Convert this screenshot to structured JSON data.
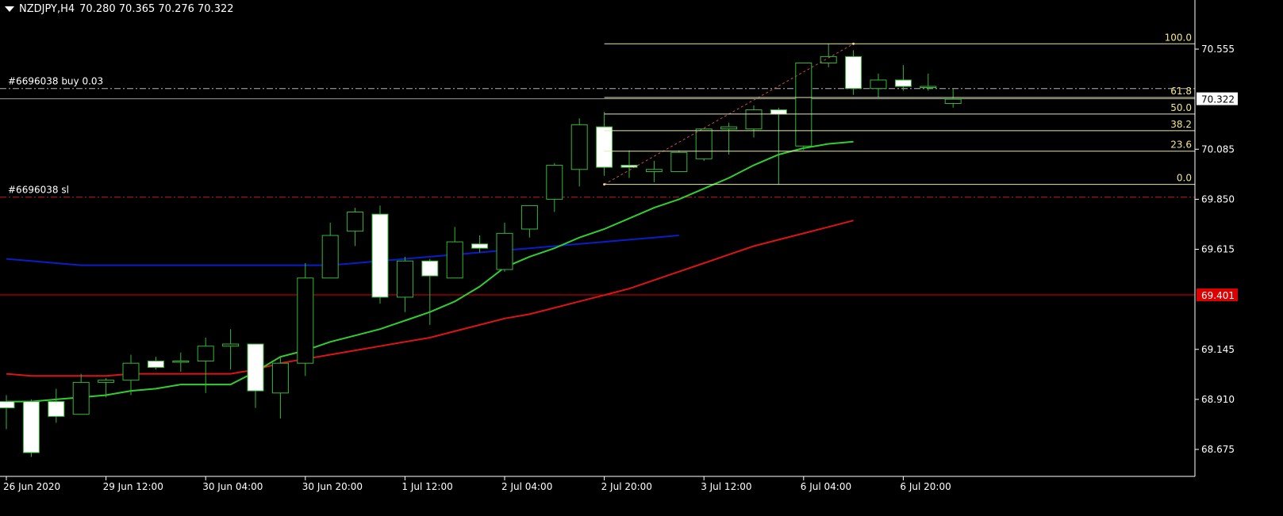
{
  "header": {
    "symbol": "NZDJPY,H4",
    "ohlc": "70.280 70.365 70.276 70.322"
  },
  "colors": {
    "background": "#000000",
    "axis": "#ffffff",
    "candle_up_body": "#000000",
    "candle_down_body": "#ffffff",
    "candle_outline": "#35b835",
    "ma_fast": "#32cd32",
    "ma_mid": "#dc1414",
    "ma_slow": "#0a1ec8",
    "fibo": "#e6e6b4",
    "fibo_label": "#f0e68c",
    "order_line": "#b4b4b4",
    "sl_line": "#c81e1e",
    "alert_line": "#dc0000",
    "alert_label_bg": "#dc0000"
  },
  "chart_data": {
    "type": "candlestick",
    "symbol": "NZDJPY",
    "timeframe": "H4",
    "y_ticks": [
      70.555,
      70.085,
      69.85,
      69.615,
      69.145,
      68.91,
      68.675
    ],
    "y_tick_labels": [
      "70.555",
      "70.085",
      "69.850",
      "69.615",
      "69.145",
      "68.910",
      "68.675"
    ],
    "x_labels": [
      "26 Jun 2020",
      "29 Jun 12:00",
      "30 Jun 04:00",
      "30 Jun 20:00",
      "1 Jul 12:00",
      "2 Jul 04:00",
      "2 Jul 20:00",
      "3 Jul 12:00",
      "6 Jul 04:00",
      "6 Jul 20:00"
    ],
    "x_label_bars": [
      0,
      4,
      8,
      12,
      16,
      20,
      24,
      28,
      32,
      36
    ],
    "current_price": 70.322,
    "current_price_label": "70.322",
    "alert_price": 69.401,
    "alert_price_label": "69.401",
    "candles": [
      {
        "o": 68.9,
        "h": 68.93,
        "l": 68.77,
        "c": 68.87
      },
      {
        "o": 68.9,
        "h": 68.91,
        "l": 68.64,
        "c": 68.66
      },
      {
        "o": 68.9,
        "h": 68.96,
        "l": 68.8,
        "c": 68.83
      },
      {
        "o": 68.84,
        "h": 69.03,
        "l": 68.84,
        "c": 68.99
      },
      {
        "o": 68.99,
        "h": 69.01,
        "l": 68.92,
        "c": 69.0
      },
      {
        "o": 69.0,
        "h": 69.12,
        "l": 68.93,
        "c": 69.08
      },
      {
        "o": 69.09,
        "h": 69.11,
        "l": 69.05,
        "c": 69.06
      },
      {
        "o": 69.09,
        "h": 69.13,
        "l": 69.04,
        "c": 69.09
      },
      {
        "o": 69.09,
        "h": 69.2,
        "l": 68.94,
        "c": 69.16
      },
      {
        "o": 69.16,
        "h": 69.24,
        "l": 69.05,
        "c": 69.17
      },
      {
        "o": 69.17,
        "h": 69.17,
        "l": 68.87,
        "c": 68.95
      },
      {
        "o": 68.94,
        "h": 69.11,
        "l": 68.82,
        "c": 69.08
      },
      {
        "o": 69.08,
        "h": 69.55,
        "l": 69.02,
        "c": 69.48
      },
      {
        "o": 69.48,
        "h": 69.74,
        "l": 69.48,
        "c": 69.68
      },
      {
        "o": 69.7,
        "h": 69.81,
        "l": 69.63,
        "c": 69.79
      },
      {
        "o": 69.78,
        "h": 69.82,
        "l": 69.36,
        "c": 69.39
      },
      {
        "o": 69.39,
        "h": 69.58,
        "l": 69.32,
        "c": 69.56
      },
      {
        "o": 69.56,
        "h": 69.57,
        "l": 69.26,
        "c": 69.49
      },
      {
        "o": 69.48,
        "h": 69.72,
        "l": 69.48,
        "c": 69.65
      },
      {
        "o": 69.64,
        "h": 69.68,
        "l": 69.6,
        "c": 69.62
      },
      {
        "o": 69.52,
        "h": 69.74,
        "l": 69.51,
        "c": 69.69
      },
      {
        "o": 69.71,
        "h": 69.82,
        "l": 69.67,
        "c": 69.82
      },
      {
        "o": 69.85,
        "h": 70.02,
        "l": 69.79,
        "c": 70.01
      },
      {
        "o": 69.99,
        "h": 70.23,
        "l": 69.91,
        "c": 70.2
      },
      {
        "o": 70.19,
        "h": 70.26,
        "l": 69.96,
        "c": 70.0
      },
      {
        "o": 70.01,
        "h": 70.08,
        "l": 69.95,
        "c": 70.0
      },
      {
        "o": 69.98,
        "h": 70.03,
        "l": 69.93,
        "c": 69.99
      },
      {
        "o": 69.98,
        "h": 70.08,
        "l": 69.98,
        "c": 70.07
      },
      {
        "o": 70.04,
        "h": 70.17,
        "l": 70.03,
        "c": 70.18
      },
      {
        "o": 70.18,
        "h": 70.21,
        "l": 70.06,
        "c": 70.19
      },
      {
        "o": 70.18,
        "h": 70.29,
        "l": 70.14,
        "c": 70.27
      },
      {
        "o": 70.27,
        "h": 70.28,
        "l": 69.92,
        "c": 70.25
      },
      {
        "o": 70.1,
        "h": 70.49,
        "l": 70.08,
        "c": 70.49
      },
      {
        "o": 70.49,
        "h": 70.58,
        "l": 70.47,
        "c": 70.52
      },
      {
        "o": 70.52,
        "h": 70.55,
        "l": 70.34,
        "c": 70.37
      },
      {
        "o": 70.37,
        "h": 70.44,
        "l": 70.33,
        "c": 70.41
      },
      {
        "o": 70.41,
        "h": 70.48,
        "l": 70.36,
        "c": 70.38
      },
      {
        "o": 70.38,
        "h": 70.44,
        "l": 70.36,
        "c": 70.38
      },
      {
        "o": 70.3,
        "h": 70.37,
        "l": 70.28,
        "c": 70.32
      }
    ],
    "ma_fast": [
      68.9,
      68.9,
      68.91,
      68.92,
      68.93,
      68.95,
      68.96,
      68.98,
      68.98,
      68.98,
      69.04,
      69.11,
      69.14,
      69.18,
      69.21,
      69.24,
      69.28,
      69.32,
      69.37,
      69.44,
      69.53,
      69.58,
      69.62,
      69.67,
      69.71,
      69.76,
      69.81,
      69.85,
      69.9,
      69.95,
      70.01,
      70.06,
      70.09,
      70.11,
      70.12
    ],
    "ma_fast_start": 0,
    "ma_mid": [
      69.03,
      69.02,
      69.02,
      69.02,
      69.02,
      69.03,
      69.03,
      69.03,
      69.03,
      69.03,
      69.05,
      69.08,
      69.1,
      69.12,
      69.14,
      69.16,
      69.18,
      69.2,
      69.23,
      69.26,
      69.29,
      69.31,
      69.34,
      69.37,
      69.4,
      69.43,
      69.47,
      69.51,
      69.55,
      69.59,
      69.63,
      69.66,
      69.69,
      69.72,
      69.75
    ],
    "ma_mid_start": 0,
    "ma_slow": [
      69.57,
      69.56,
      69.55,
      69.54,
      69.54,
      69.54,
      69.54,
      69.54,
      69.54,
      69.54,
      69.54,
      69.54,
      69.54,
      69.54,
      69.55,
      69.56,
      69.57,
      69.58,
      69.59,
      69.6,
      69.61,
      69.62,
      69.63,
      69.64,
      69.65,
      69.66,
      69.67,
      69.68
    ],
    "ma_slow_start": 0,
    "fibo": {
      "bar_start": 24,
      "bar_end": 39,
      "anchor_bar_low": 24,
      "anchor_bar_high": 34,
      "low": 69.92,
      "high": 70.58,
      "levels": [
        {
          "value": 100.0,
          "label": "100.0"
        },
        {
          "value": 61.8,
          "label": "61.8"
        },
        {
          "value": 50.0,
          "label": "50.0"
        },
        {
          "value": 38.2,
          "label": "38.2"
        },
        {
          "value": 23.6,
          "label": "23.6"
        },
        {
          "value": 0.0,
          "label": "0.0"
        }
      ]
    },
    "orders": [
      {
        "label": "#6696038 buy 0.03",
        "price": 70.37,
        "style": "order"
      },
      {
        "label": "#6696038 sl",
        "price": 69.86,
        "style": "sl"
      }
    ]
  }
}
